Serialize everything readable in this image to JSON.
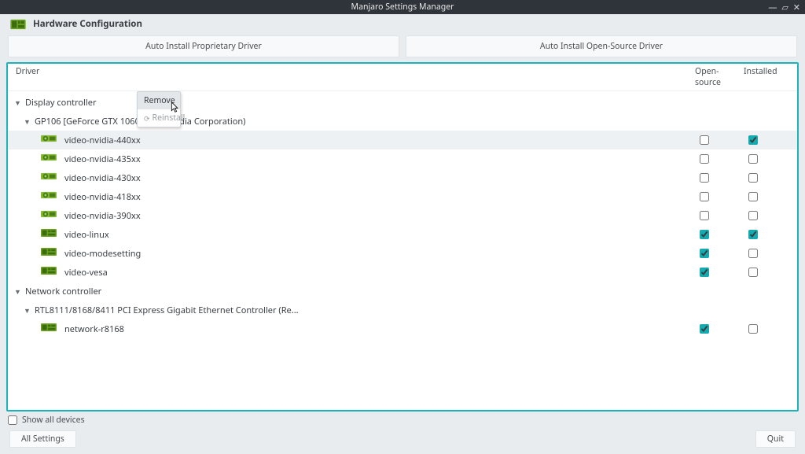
{
  "window": {
    "title": "Manjaro Settings Manager"
  },
  "header": {
    "title": "Hardware Configuration"
  },
  "buttons": {
    "proprietary": "Auto Install Proprietary Driver",
    "opensource": "Auto Install Open-Source Driver"
  },
  "columns": {
    "driver": "Driver",
    "open_source": "Open-source",
    "installed": "Installed"
  },
  "context_menu": {
    "remove": "Remove",
    "reinstall": "Reinstall"
  },
  "tree": {
    "categories": [
      {
        "label": "Display controller",
        "devices": [
          {
            "label": "GP106 [GeForce GTX 1060 6GB] (nVidia Corporation)",
            "drivers": [
              {
                "name": "video-nvidia-440xx",
                "open": false,
                "installed": true,
                "iconType": "gpu",
                "selected": true
              },
              {
                "name": "video-nvidia-435xx",
                "open": false,
                "installed": false,
                "iconType": "gpu"
              },
              {
                "name": "video-nvidia-430xx",
                "open": false,
                "installed": false,
                "iconType": "gpu"
              },
              {
                "name": "video-nvidia-418xx",
                "open": false,
                "installed": false,
                "iconType": "gpu"
              },
              {
                "name": "video-nvidia-390xx",
                "open": false,
                "installed": false,
                "iconType": "gpu"
              },
              {
                "name": "video-linux",
                "open": true,
                "installed": true,
                "iconType": "board"
              },
              {
                "name": "video-modesetting",
                "open": true,
                "installed": false,
                "iconType": "board"
              },
              {
                "name": "video-vesa",
                "open": true,
                "installed": false,
                "iconType": "board"
              }
            ]
          }
        ]
      },
      {
        "label": "Network controller",
        "devices": [
          {
            "label": "RTL8111/8168/8411 PCI Express Gigabit Ethernet Controller (Re...",
            "drivers": [
              {
                "name": "network-r8168",
                "open": true,
                "installed": false,
                "iconType": "board"
              }
            ]
          }
        ]
      }
    ]
  },
  "footer": {
    "show_all": "Show all devices",
    "all_settings": "All Settings",
    "quit": "Quit"
  }
}
